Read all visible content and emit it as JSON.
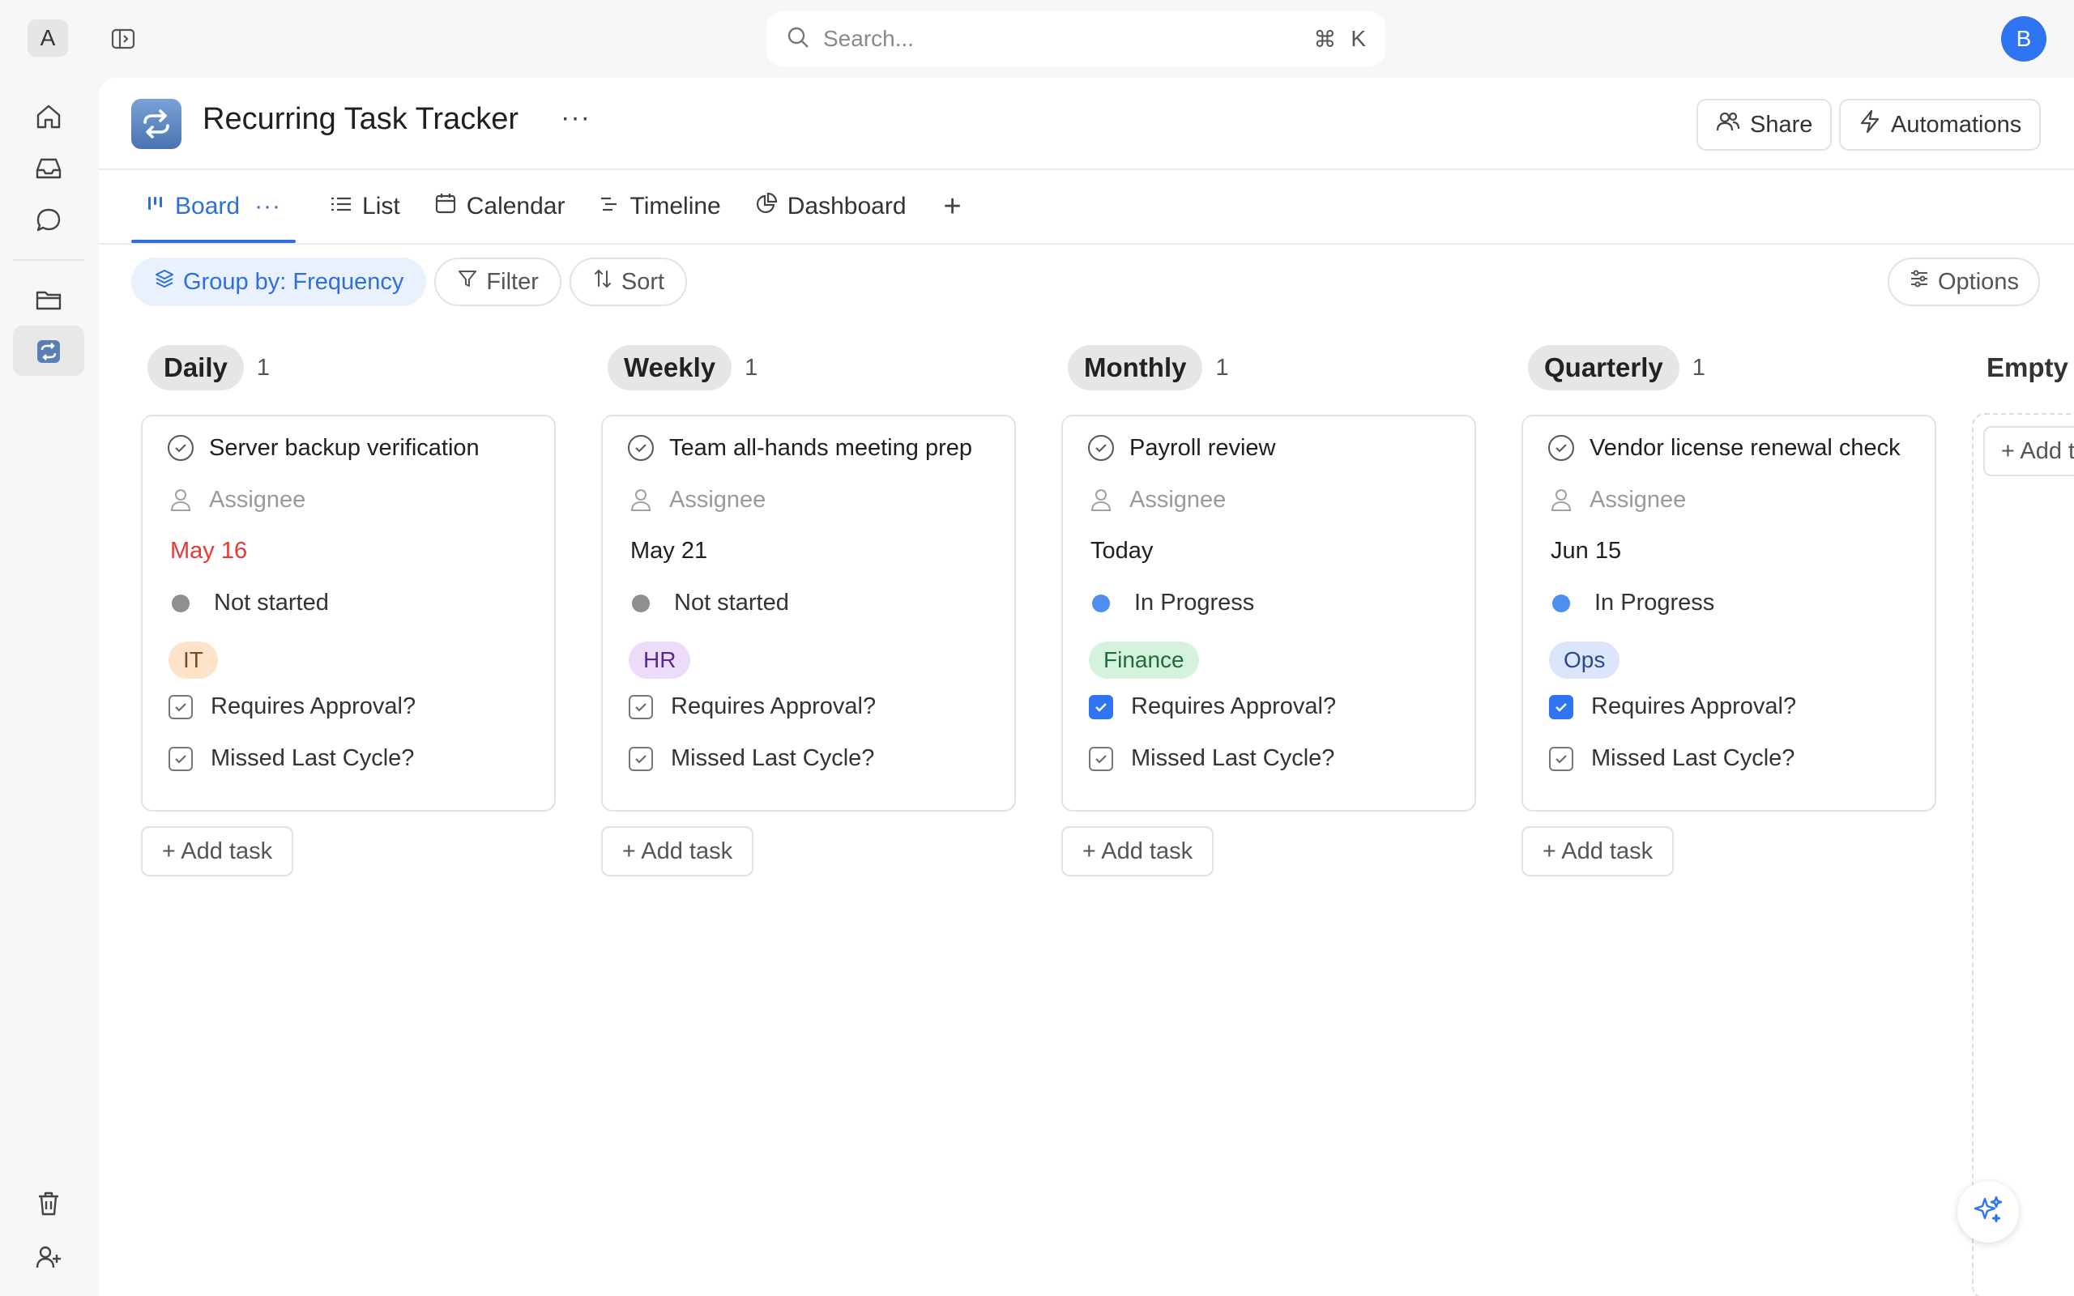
{
  "app": {
    "workspace_initial": "A",
    "user_initial": "B",
    "accent_color": "#2f6fdb"
  },
  "search": {
    "placeholder": "Search...",
    "shortcut_mod": "⌘",
    "shortcut_key": "K"
  },
  "rail": {
    "items": [
      "home-icon",
      "inbox-icon",
      "chat-icon",
      "folder-icon",
      "recurring-icon"
    ],
    "bottom": [
      "trash-icon",
      "add-user-icon"
    ],
    "active": "recurring-icon"
  },
  "page": {
    "title": "Recurring Task Tracker",
    "more": "···",
    "share_label": "Share",
    "automations_label": "Automations"
  },
  "tabs": {
    "board": "Board",
    "board_more": "···",
    "list": "List",
    "calendar": "Calendar",
    "timeline": "Timeline",
    "dashboard": "Dashboard",
    "add": "+"
  },
  "toolbar": {
    "group_by": "Group by: Frequency",
    "filter": "Filter",
    "sort": "Sort",
    "options": "Options"
  },
  "columns": [
    {
      "name": "Daily",
      "count": "1",
      "card": {
        "title": "Server backup verification",
        "assignee": "Assignee",
        "date": "May 16",
        "date_overdue": true,
        "status": "Not started",
        "status_color": "#8f8f8f",
        "tag": "IT",
        "tag_bg": "#fde3c9",
        "tag_fg": "#7a4b1c",
        "approval_label": "Requires Approval?",
        "approval_checked": false,
        "missed_label": "Missed Last Cycle?",
        "missed_checked": false
      },
      "add_label": "+ Add task"
    },
    {
      "name": "Weekly",
      "count": "1",
      "card": {
        "title": "Team all-hands meeting prep",
        "assignee": "Assignee",
        "date": "May 21",
        "date_overdue": false,
        "status": "Not started",
        "status_color": "#8f8f8f",
        "tag": "HR",
        "tag_bg": "#ecdcfa",
        "tag_fg": "#5b2a86",
        "approval_label": "Requires Approval?",
        "approval_checked": false,
        "missed_label": "Missed Last Cycle?",
        "missed_checked": false
      },
      "add_label": "+ Add task"
    },
    {
      "name": "Monthly",
      "count": "1",
      "card": {
        "title": "Payroll review",
        "assignee": "Assignee",
        "date": "Today",
        "date_overdue": false,
        "status": "In Progress",
        "status_color": "#4d8ef0",
        "tag": "Finance",
        "tag_bg": "#d5f2df",
        "tag_fg": "#1f6b3a",
        "approval_label": "Requires Approval?",
        "approval_checked": true,
        "missed_label": "Missed Last Cycle?",
        "missed_checked": false
      },
      "add_label": "+ Add task"
    },
    {
      "name": "Quarterly",
      "count": "1",
      "card": {
        "title": "Vendor license renewal check",
        "assignee": "Assignee",
        "date": "Jun 15",
        "date_overdue": false,
        "status": "In Progress",
        "status_color": "#4d8ef0",
        "tag": "Ops",
        "tag_bg": "#dce6fb",
        "tag_fg": "#2b4a8a",
        "approval_label": "Requires Approval?",
        "approval_checked": true,
        "missed_label": "Missed Last Cycle?",
        "missed_checked": false
      },
      "add_label": "+ Add task"
    }
  ],
  "empty_column": {
    "name": "Empty",
    "add_label": "+ Add task"
  }
}
